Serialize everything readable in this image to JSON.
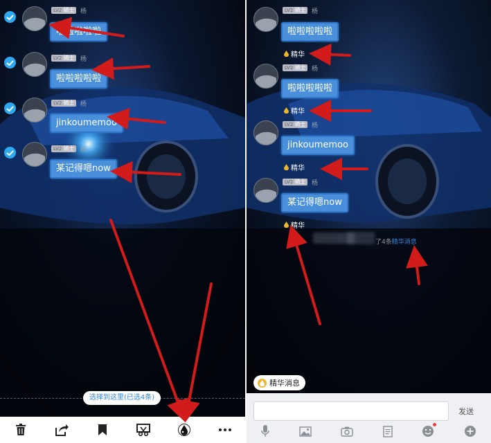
{
  "left": {
    "messages": [
      {
        "level": "LV2",
        "rank": "骑士",
        "nick": "杨",
        "text": "啦啦啦啦啦"
      },
      {
        "level": "LV2",
        "rank": "骑士",
        "nick": "杨",
        "text": "啦啦啦啦啦"
      },
      {
        "level": "LV2",
        "rank": "骑士",
        "nick": "杨",
        "text": "jinkoumemoo"
      },
      {
        "level": "LV2",
        "rank": "骑士",
        "nick": "杨",
        "text": "某记得嗯now"
      }
    ],
    "select_pill": "选择到这里(已选4条)",
    "toolbar": [
      "delete-icon",
      "share-icon",
      "bookmark-icon",
      "scissors-icon",
      "essence-drop-icon",
      "more-icon"
    ]
  },
  "right": {
    "messages": [
      {
        "level": "LV2",
        "rank": "骑士",
        "nick": "杨",
        "text": "啦啦啦啦啦",
        "tag": "精华"
      },
      {
        "level": "LV2",
        "rank": "骑士",
        "nick": "杨",
        "text": "啦啦啦啦啦",
        "tag": "精华"
      },
      {
        "level": "LV2",
        "rank": "骑士",
        "nick": "杨",
        "text": "jinkoumemoo",
        "tag": "精华"
      },
      {
        "level": "LV2",
        "rank": "骑士",
        "nick": "杨",
        "text": "某记得嗯now",
        "tag": "精华"
      }
    ],
    "system_text": "了4条",
    "system_link": "精华消息",
    "essence_pill": "精华消息",
    "send_label": "发送",
    "tools": [
      "mic-icon",
      "image-icon",
      "camera-icon",
      "file-icon",
      "emoji-icon",
      "plus-icon"
    ]
  },
  "colors": {
    "bubble": "#4a8fd9",
    "accent": "#2f86d8",
    "arrow": "#d21b1b",
    "gold": "#f1b428"
  }
}
